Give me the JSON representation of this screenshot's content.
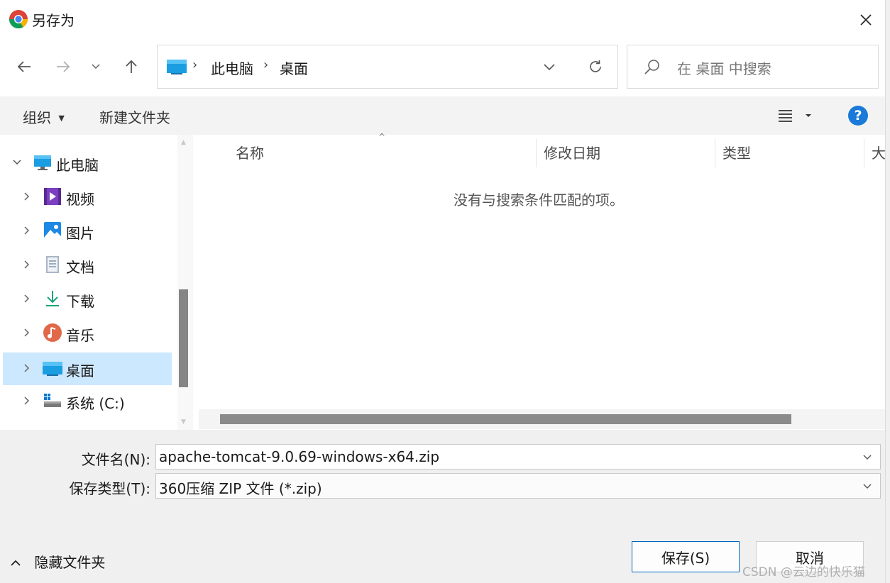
{
  "window": {
    "title": "另存为"
  },
  "breadcrumb": [
    "此电脑",
    "桌面"
  ],
  "search": {
    "placeholder": "在 桌面 中搜索"
  },
  "toolbar": {
    "organize": "组织",
    "new_folder": "新建文件夹"
  },
  "nav": {
    "items": [
      {
        "label": "此电脑",
        "icon": "computer-icon",
        "expanded": true
      },
      {
        "label": "视频",
        "icon": "video-icon"
      },
      {
        "label": "图片",
        "icon": "pictures-icon"
      },
      {
        "label": "文档",
        "icon": "documents-icon"
      },
      {
        "label": "下载",
        "icon": "download-icon"
      },
      {
        "label": "音乐",
        "icon": "music-icon"
      },
      {
        "label": "桌面",
        "icon": "desktop-icon",
        "selected": true
      },
      {
        "label": "系统 (C:)",
        "icon": "drive-icon"
      }
    ]
  },
  "columns": [
    "名称",
    "修改日期",
    "类型",
    "大"
  ],
  "empty_message": "没有与搜索条件匹配的项。",
  "form": {
    "filename_label": "文件名(N):",
    "filename_value": "apache-tomcat-9.0.69-windows-x64.zip",
    "filetype_label": "保存类型(T):",
    "filetype_value": "360压缩 ZIP 文件 (*.zip)"
  },
  "hide_folders": "隐藏文件夹",
  "buttons": {
    "save": "保存(S)",
    "cancel": "取消"
  },
  "watermark": "CSDN @云边的快乐猫",
  "colors": {
    "accent": "#0067c0",
    "selection": "#cce8ff",
    "help": "#1a7ad9"
  }
}
